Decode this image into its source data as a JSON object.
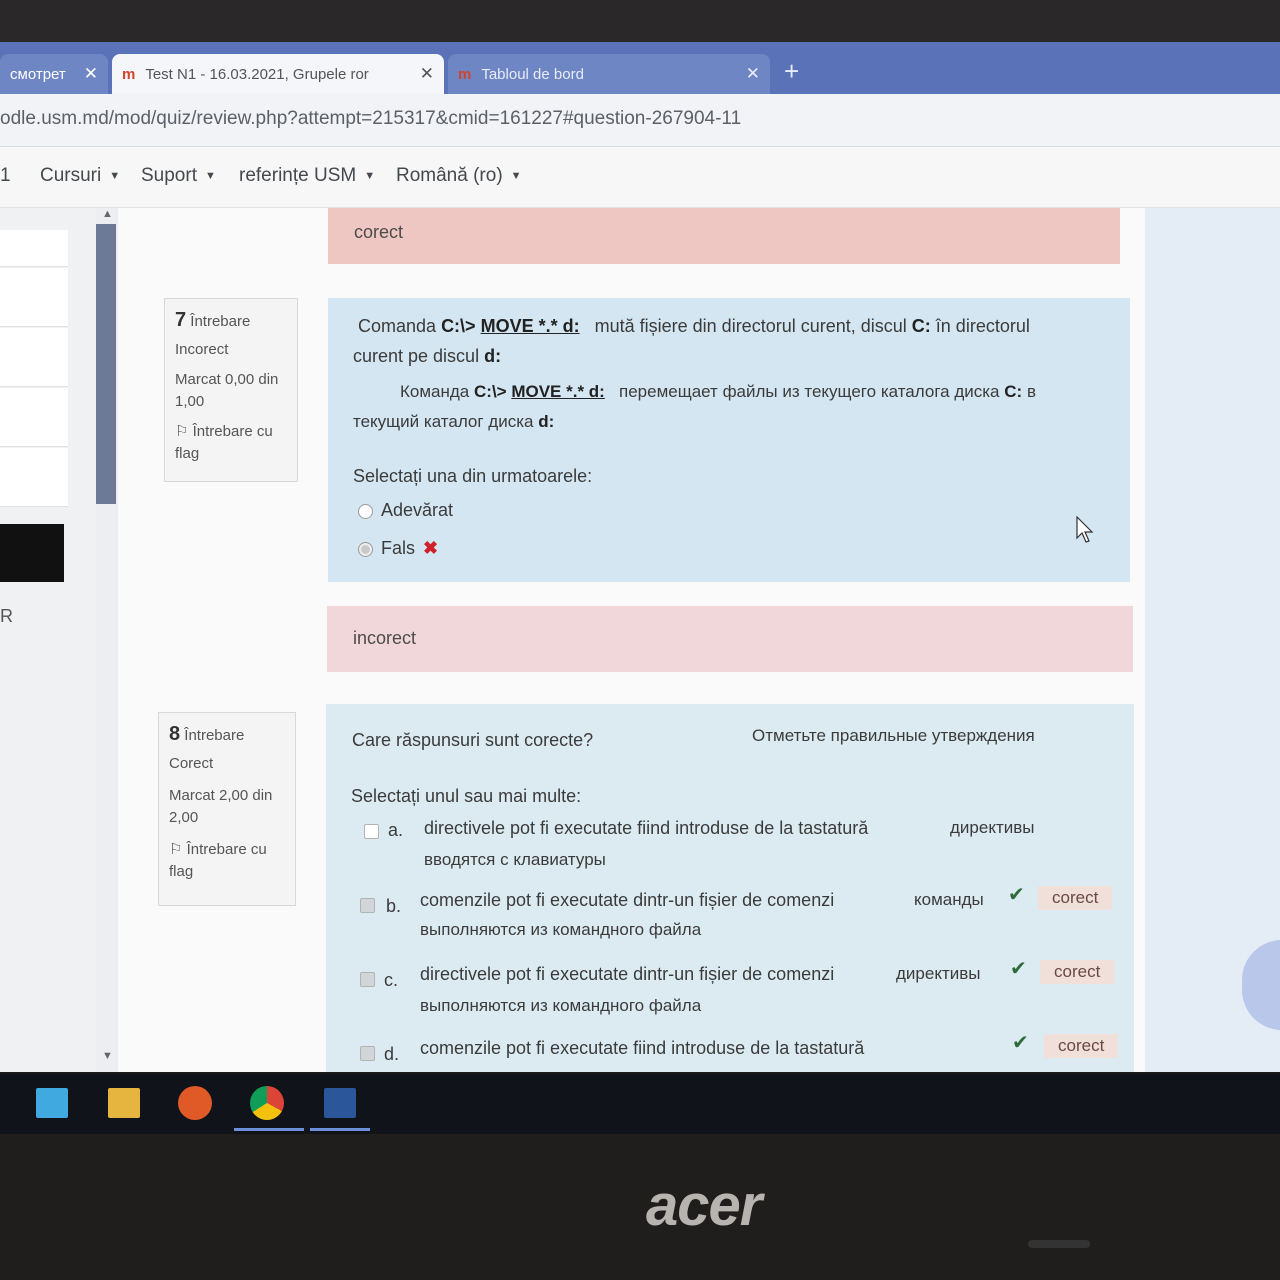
{
  "browser": {
    "tabs": [
      {
        "label": "смотрет",
        "close": "✕"
      },
      {
        "label": "Test N1 - 16.03.2021, Grupele ror",
        "close": "✕"
      },
      {
        "label": "Tabloul de bord",
        "close": "✕"
      }
    ],
    "new_tab": "+",
    "url": "odle.usm.md/mod/quiz/review.php?attempt=215317&cmid=161227#question-267904-11"
  },
  "nav": {
    "left_stub": "1",
    "items": [
      "Cursuri",
      "Suport",
      "referințe USM",
      "Română (ro)"
    ]
  },
  "drawer": {
    "letter": "R"
  },
  "feedback_prev": "corect",
  "q7": {
    "number": "7",
    "label": "Întrebare",
    "state": "Incorect",
    "mark_1": "Marcat 0,00 din",
    "mark_2": "1,00",
    "flag_1": "Întrebare cu",
    "flag_2": "flag",
    "ro_a": "Comanda",
    "ro_cmd": "C:\\>",
    "ro_move": "MOVE *.* d:",
    "ro_b": "mută fișiere din directorul curent, discul",
    "ro_c": "C:",
    "ro_d": "în directorul",
    "ro_line2": "curent pe discul",
    "ro_d2": "d:",
    "ru_a": "Команда",
    "ru_cmd": "C:\\>",
    "ru_move": "MOVE *.* d:",
    "ru_b": "перемещает файлы из текущего каталога диска",
    "ru_c": "C:",
    "ru_d": "в",
    "ru_line2": "текущий каталог диска",
    "ru_d2": "d:",
    "prompt": "Selectați una din urmatoarele:",
    "opt_true": "Adevărat",
    "opt_false": "Fals",
    "feedback": "incorect"
  },
  "q8": {
    "number": "8",
    "label": "Întrebare",
    "state": "Corect",
    "mark_1": "Marcat 2,00 din",
    "mark_2": "2,00",
    "flag_1": "Întrebare cu",
    "flag_2": "flag",
    "question_ro": "Care răspunsuri sunt corecte?",
    "question_ru": "Отметьте правильные утверждения",
    "prompt": "Selectați unul sau mai multe:",
    "options": [
      {
        "letter": "a.",
        "ro": "directivele pot fi executate fiind introduse de la tastatură",
        "ru1": "директивы",
        "ru2": "вводятся с клавиатуры",
        "badge": ""
      },
      {
        "letter": "b.",
        "ro": "comenzile pot fi executate dintr-un fișier de comenzi",
        "ru1": "команды",
        "ru2": "выполняются  из командного файла",
        "badge": "corect"
      },
      {
        "letter": "c.",
        "ro": "directivele pot fi executate dintr-un fișier de comenzi",
        "ru1": "директивы",
        "ru2": "выполняются  из командного файла",
        "badge": "corect"
      },
      {
        "letter": "d.",
        "ro": "comenzile pot fi executate fiind introduse de la tastatură",
        "ru1": "",
        "ru2": "",
        "badge": "corect"
      }
    ]
  },
  "brand": "acer"
}
